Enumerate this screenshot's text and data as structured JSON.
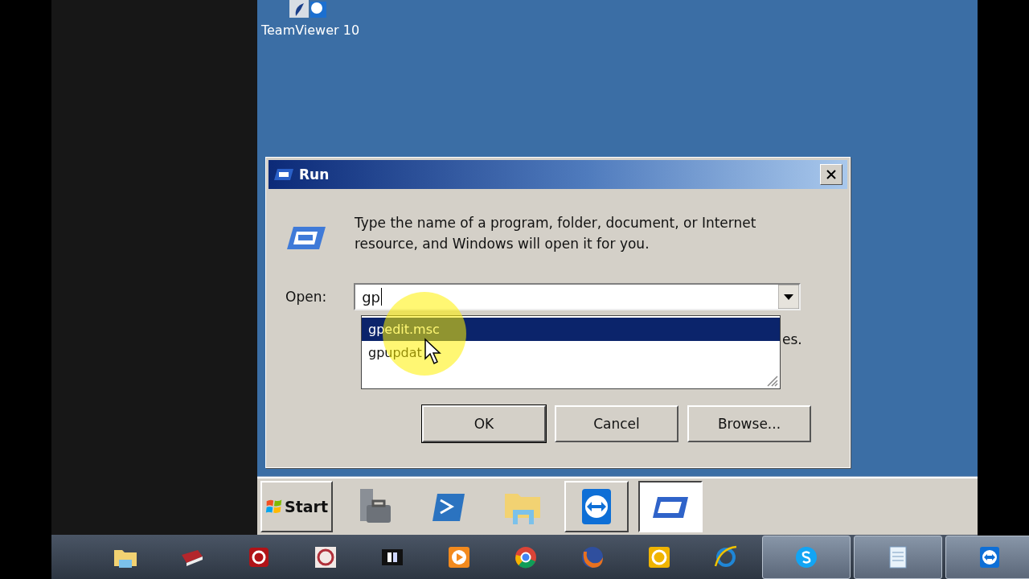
{
  "desktop": {
    "icons": [
      {
        "label": "TeamViewer 10"
      }
    ]
  },
  "dialog": {
    "title": "Run",
    "description": "Type the name of a program, folder, document, or Internet resource, and Windows will open it for you.",
    "open_label": "Open:",
    "value": "gp",
    "hidden_note": "es.",
    "suggestions": [
      {
        "label": "gpedit.msc",
        "selected": true
      },
      {
        "label": "gpupdat",
        "selected": false
      }
    ],
    "buttons": [
      {
        "label": "OK",
        "default": true
      },
      {
        "label": "Cancel",
        "default": false
      },
      {
        "label": "Browse...",
        "default": false
      }
    ]
  },
  "inner_taskbar": {
    "start": "Start",
    "items": [
      {
        "kind": "toolbox",
        "running": false,
        "active": false
      },
      {
        "kind": "shell",
        "running": false,
        "active": false
      },
      {
        "kind": "folder",
        "running": false,
        "active": false
      },
      {
        "kind": "remote",
        "running": true,
        "active": false
      },
      {
        "kind": "run",
        "running": false,
        "active": true
      }
    ]
  },
  "taskbar": {
    "items": [
      {
        "kind": "folder",
        "running": false
      },
      {
        "kind": "book",
        "running": false
      },
      {
        "kind": "redc",
        "running": false
      },
      {
        "kind": "pattern",
        "running": false
      },
      {
        "kind": "dark",
        "running": false
      },
      {
        "kind": "player",
        "running": false
      },
      {
        "kind": "chrome",
        "running": false
      },
      {
        "kind": "firefox",
        "running": false
      },
      {
        "kind": "orange",
        "running": false
      },
      {
        "kind": "ie",
        "running": false
      },
      {
        "kind": "skype",
        "running": true
      },
      {
        "kind": "notepad",
        "running": true
      },
      {
        "kind": "remote",
        "running": true
      }
    ]
  }
}
